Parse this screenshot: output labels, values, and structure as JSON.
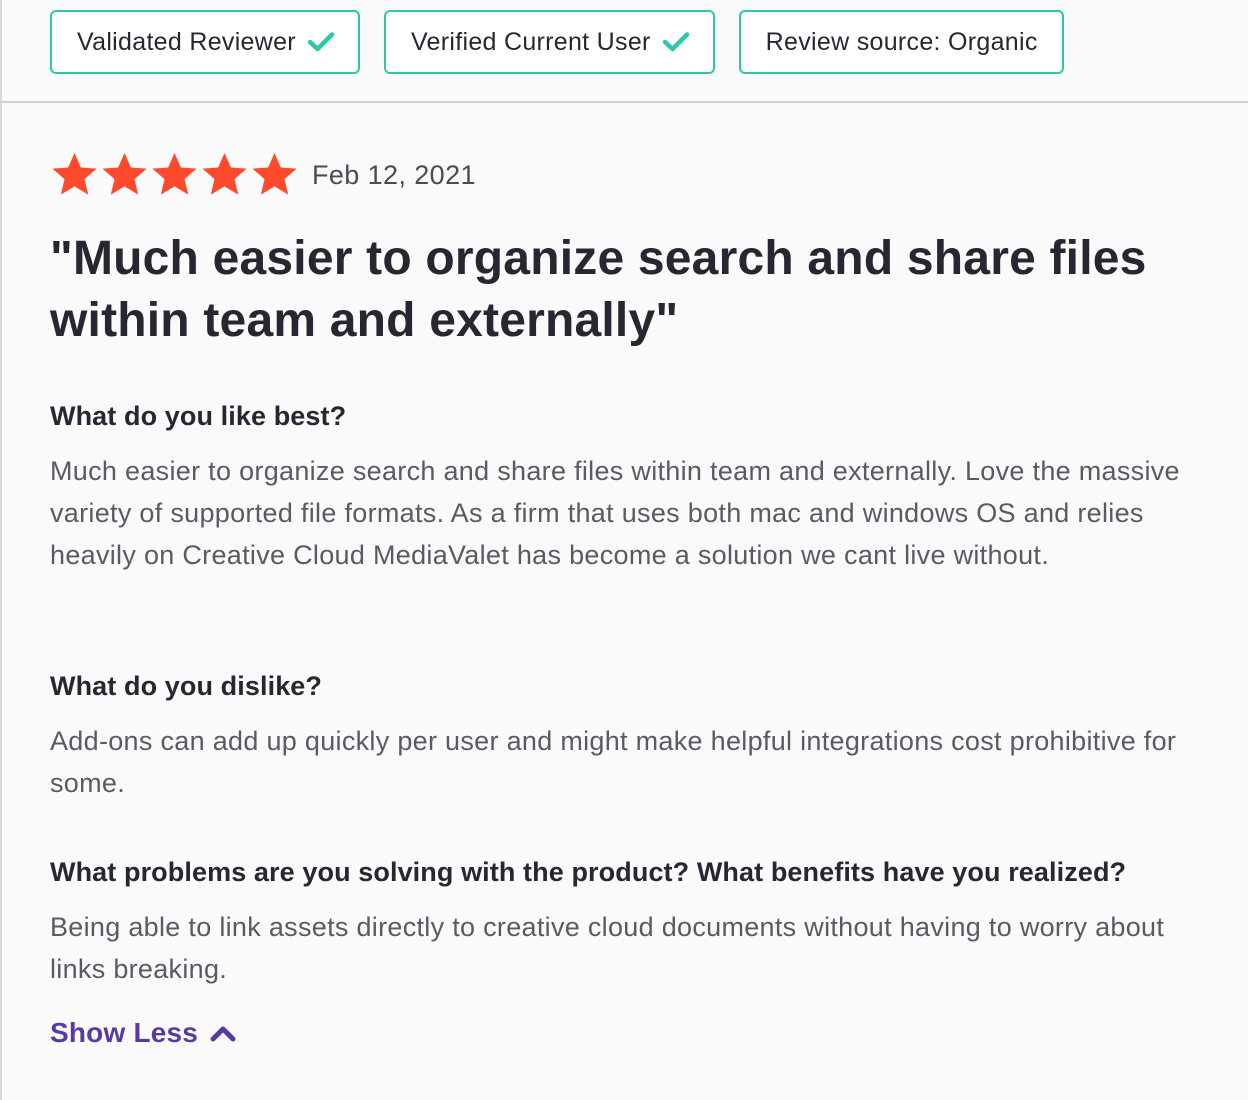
{
  "badges": [
    {
      "label": "Validated Reviewer",
      "icon": "check-icon"
    },
    {
      "label": "Verified Current User",
      "icon": "check-icon"
    },
    {
      "label": "Review source: Organic"
    }
  ],
  "review": {
    "rating": 5,
    "rating_max": 5,
    "date": "Feb 12, 2021",
    "title": "\"Much easier to organize search and share files within team and externally\"",
    "sections": [
      {
        "question": "What do you like best?",
        "answer": "Much easier to organize search and share files within team and externally. Love the massive variety of supported file formats. As a firm that uses both mac and windows OS and relies heavily on Creative Cloud MediaValet has become a solution we cant live without."
      },
      {
        "question": "What do you dislike?",
        "answer": "Add-ons can add up quickly per user and might make helpful integrations cost prohibitive for some."
      },
      {
        "question": "What problems are you solving with the product? What benefits have you realized?",
        "answer": "Being able to link assets directly to creative cloud documents without having to worry about links breaking."
      }
    ],
    "show_less_label": "Show Less"
  },
  "colors": {
    "badge_border": "#2cc9a8",
    "check": "#2cc9a8",
    "star": "#ff492c",
    "link": "#5a39a2",
    "heading": "#272732",
    "body": "#5a5a64"
  }
}
